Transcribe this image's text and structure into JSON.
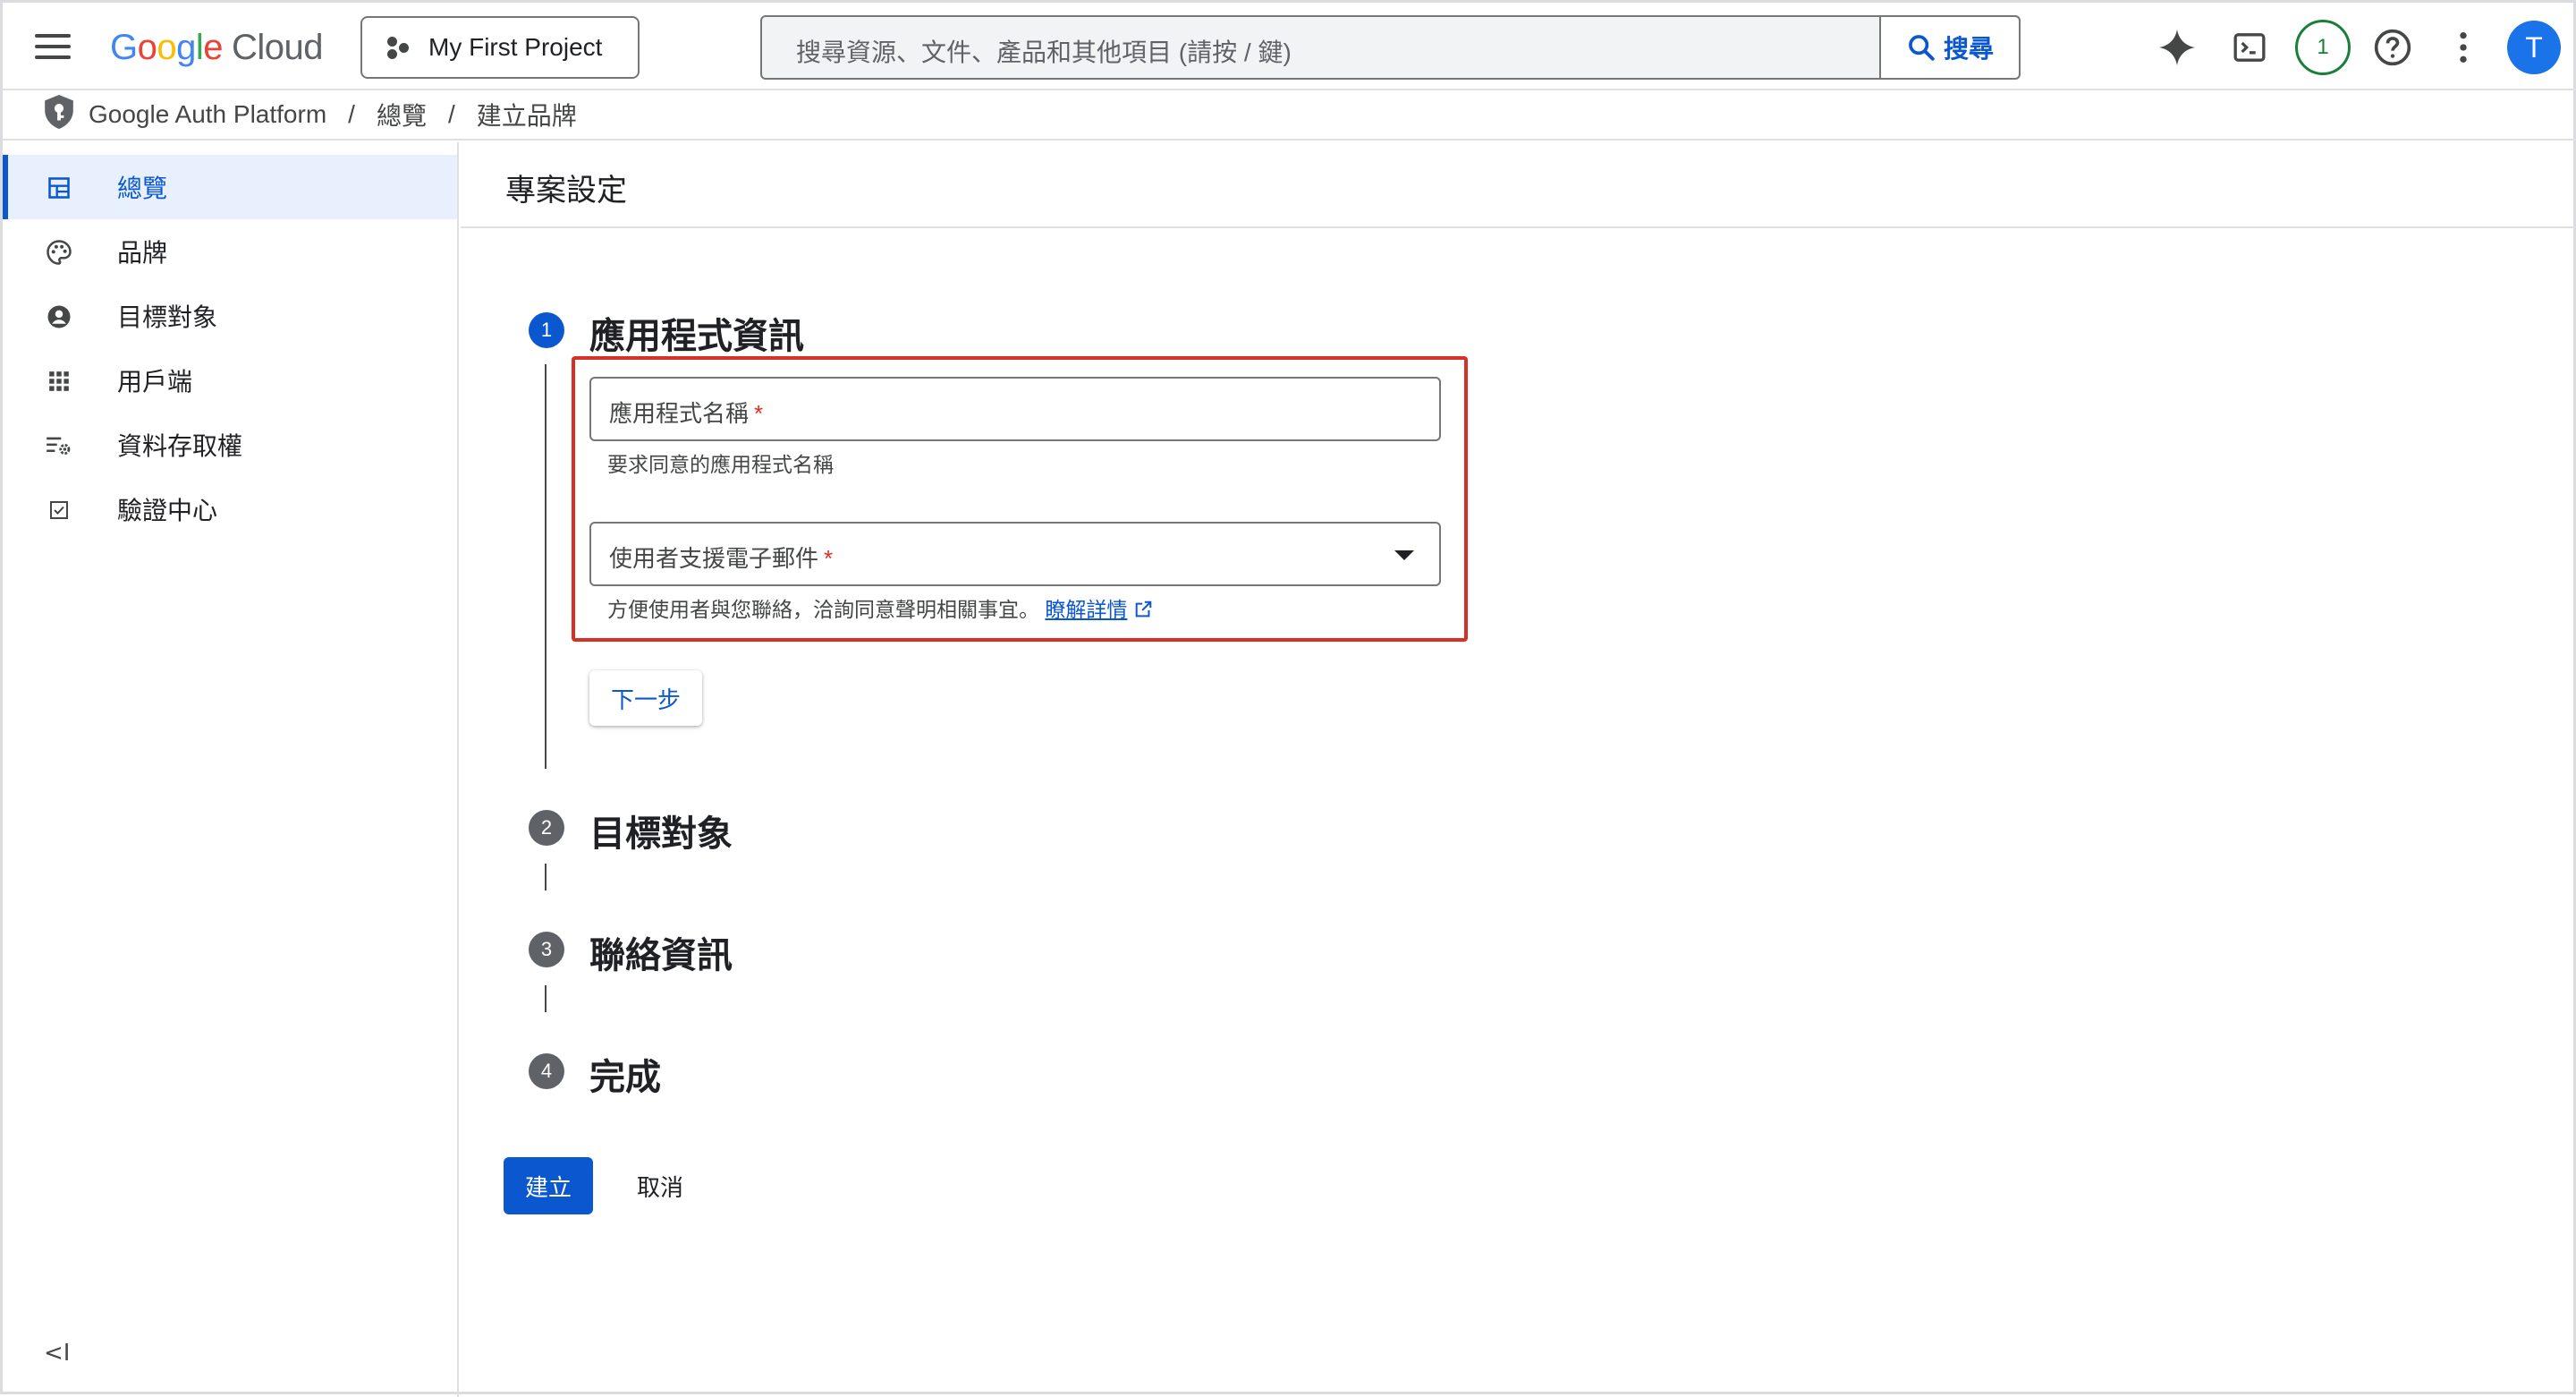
{
  "header": {
    "logo": {
      "G": "G",
      "o1": "o",
      "o2": "o",
      "g": "g",
      "l": "l",
      "e": "e",
      "cloud": "Cloud"
    },
    "project_name": "My First Project",
    "search_placeholder": "搜尋資源、文件、產品和其他項目 (請按 / 鍵)",
    "search_button": "搜尋",
    "notification_count": "1",
    "avatar_initial": "T"
  },
  "breadcrumb": {
    "product": "Google Auth Platform",
    "items": [
      "總覽",
      "建立品牌"
    ],
    "separator": "/"
  },
  "sidebar": {
    "items": [
      {
        "label": "總覽",
        "icon": "dashboard-icon",
        "active": true
      },
      {
        "label": "品牌",
        "icon": "palette-icon",
        "active": false
      },
      {
        "label": "目標對象",
        "icon": "account-circle-icon",
        "active": false
      },
      {
        "label": "用戶端",
        "icon": "apps-grid-icon",
        "active": false
      },
      {
        "label": "資料存取權",
        "icon": "data-settings-icon",
        "active": false
      },
      {
        "label": "驗證中心",
        "icon": "check-box-icon",
        "active": false
      }
    ],
    "collapse_label": "<I"
  },
  "main": {
    "page_title": "專案設定",
    "steps": [
      {
        "number": "1",
        "title": "應用程式資訊",
        "active": true
      },
      {
        "number": "2",
        "title": "目標對象",
        "active": false
      },
      {
        "number": "3",
        "title": "聯絡資訊",
        "active": false
      },
      {
        "number": "4",
        "title": "完成",
        "active": false
      }
    ],
    "app_name_field": {
      "label": "應用程式名稱",
      "required_mark": "*",
      "helper": "要求同意的應用程式名稱"
    },
    "support_email_field": {
      "label": "使用者支援電子郵件",
      "required_mark": "*",
      "helper": "方便使用者與您聯絡，洽詢同意聲明相關事宜。",
      "learn_more": "瞭解詳情"
    },
    "next_button": "下一步",
    "create_button": "建立",
    "cancel_button": "取消"
  },
  "colors": {
    "primary": "#0b57d0",
    "active_bg": "#e8f0fe",
    "highlight_border": "#d93025",
    "required": "#d93025",
    "badge_green": "#188038",
    "step_inactive": "#5f6368"
  }
}
